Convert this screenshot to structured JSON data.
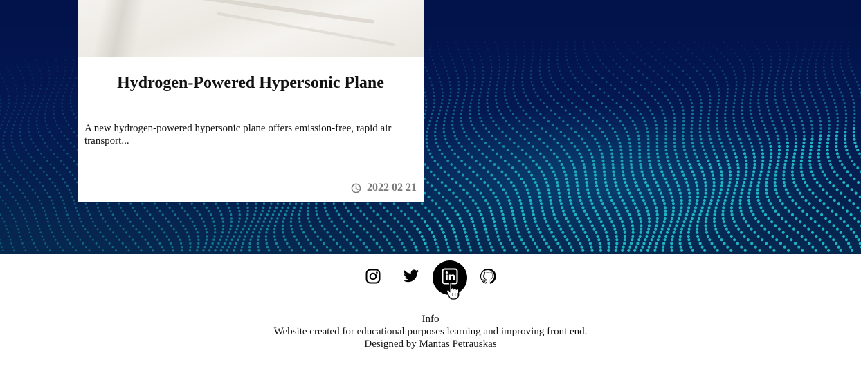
{
  "article": {
    "title": "Hydrogen-Powered Hypersonic Plane",
    "description": "A new hydrogen-powered hypersonic plane offers emission-free, rapid air transport...",
    "date": "2022 02 21"
  },
  "social": {
    "items": [
      {
        "icon": "instagram-icon",
        "active": false
      },
      {
        "icon": "twitter-icon",
        "active": false
      },
      {
        "icon": "linkedin-icon",
        "active": true
      },
      {
        "icon": "github-icon",
        "active": false
      }
    ]
  },
  "footer": {
    "heading": "Info",
    "line1": "Website created for educational purposes learning and improving front end.",
    "line2": "Designed by Mantas Petrauskas"
  },
  "colors": {
    "hero_background": "#02124a",
    "dots": "#1fb3c4",
    "active_icon_bg": "#000000",
    "date_text": "#7a7a7a"
  }
}
